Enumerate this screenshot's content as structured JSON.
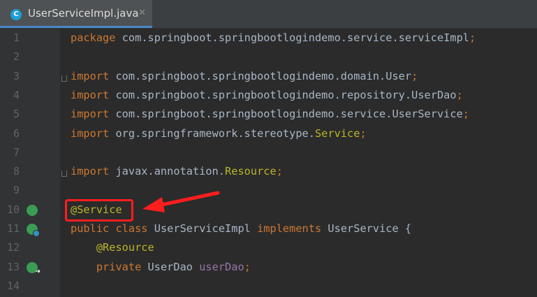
{
  "tab": {
    "icon_letter": "C",
    "title": "UserServiceImpl.java",
    "close": "✕"
  },
  "lines": [
    {
      "n": "1",
      "segments": [
        {
          "t": "package ",
          "c": "kw"
        },
        {
          "t": "com.springboot.springbootlogindemo.service.serviceImpl",
          "c": "pkg"
        },
        {
          "t": ";",
          "c": "kw"
        }
      ]
    },
    {
      "n": "2",
      "segments": []
    },
    {
      "n": "3",
      "segments": [
        {
          "t": "import ",
          "c": "kw"
        },
        {
          "t": "com.springboot.springbootlogindemo.domain.User",
          "c": "pkg"
        },
        {
          "t": ";",
          "c": "kw"
        }
      ]
    },
    {
      "n": "4",
      "segments": [
        {
          "t": "import ",
          "c": "kw"
        },
        {
          "t": "com.springboot.springbootlogindemo.repository.UserDao",
          "c": "pkg"
        },
        {
          "t": ";",
          "c": "kw"
        }
      ]
    },
    {
      "n": "5",
      "segments": [
        {
          "t": "import ",
          "c": "kw"
        },
        {
          "t": "com.springboot.springbootlogindemo.service.UserService",
          "c": "pkg"
        },
        {
          "t": ";",
          "c": "kw"
        }
      ]
    },
    {
      "n": "6",
      "segments": [
        {
          "t": "import ",
          "c": "kw"
        },
        {
          "t": "org.springframework.stereotype.",
          "c": "pkg"
        },
        {
          "t": "Service",
          "c": "ann"
        },
        {
          "t": ";",
          "c": "kw"
        }
      ]
    },
    {
      "n": "7",
      "segments": []
    },
    {
      "n": "8",
      "segments": [
        {
          "t": "import ",
          "c": "kw"
        },
        {
          "t": "javax.annotation.",
          "c": "pkg"
        },
        {
          "t": "Resource",
          "c": "ann"
        },
        {
          "t": ";",
          "c": "kw"
        }
      ]
    },
    {
      "n": "9",
      "segments": []
    },
    {
      "n": "10",
      "segments": [
        {
          "t": "@Service",
          "c": "ann"
        }
      ]
    },
    {
      "n": "11",
      "segments": [
        {
          "t": "public class ",
          "c": "kw"
        },
        {
          "t": "UserServiceImpl ",
          "c": "pkg"
        },
        {
          "t": "implements ",
          "c": "kw"
        },
        {
          "t": "UserService {",
          "c": "pkg"
        }
      ]
    },
    {
      "n": "12",
      "segments": [
        {
          "t": "    ",
          "c": "pkg"
        },
        {
          "t": "@Resource",
          "c": "ann"
        }
      ]
    },
    {
      "n": "13",
      "segments": [
        {
          "t": "    ",
          "c": "pkg"
        },
        {
          "t": "private ",
          "c": "kw"
        },
        {
          "t": "UserDao ",
          "c": "pkg"
        },
        {
          "t": "userDao",
          "c": "fld"
        },
        {
          "t": ";",
          "c": "kw"
        }
      ]
    },
    {
      "n": "14",
      "segments": []
    }
  ],
  "gutter_icons": [
    {
      "line": "10",
      "name": "spring-bean-icon"
    },
    {
      "line": "11",
      "name": "implements-interface-icon"
    },
    {
      "line": "13",
      "name": "autowired-navigate-icon"
    }
  ],
  "colors": {
    "keyword": "#cc7832",
    "annotation": "#bbb529",
    "field": "#9876aa",
    "text": "#a9b7c6",
    "line_number": "#606366",
    "highlight": "#ff1e1e"
  }
}
